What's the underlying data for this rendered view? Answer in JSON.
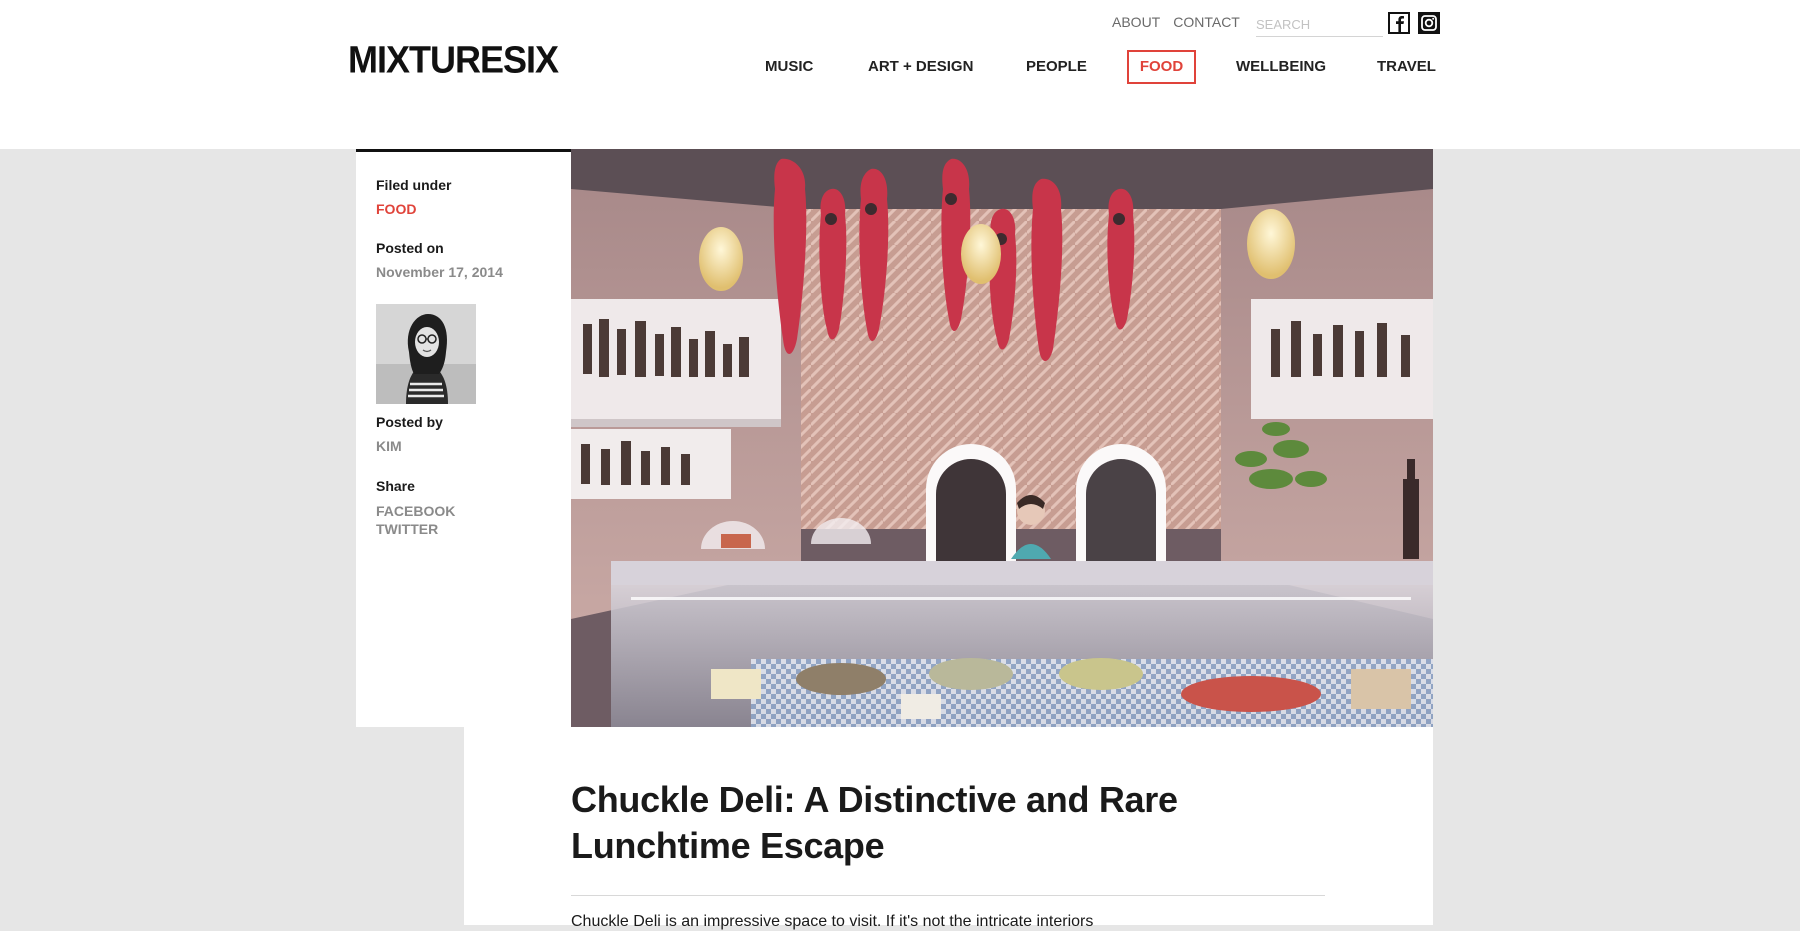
{
  "site": {
    "logo": "MIXTURESIX"
  },
  "utility_nav": {
    "about": "ABOUT",
    "contact": "CONTACT",
    "search_placeholder": "SEARCH",
    "social_icons": [
      "facebook-icon",
      "instagram-icon"
    ]
  },
  "main_nav": {
    "items": [
      {
        "label": "MUSIC"
      },
      {
        "label": "ART + DESIGN"
      },
      {
        "label": "PEOPLE"
      },
      {
        "label": "FOOD",
        "active": true
      },
      {
        "label": "WELLBEING"
      },
      {
        "label": "TRAVEL"
      }
    ]
  },
  "sidebar": {
    "filed_under_label": "Filed under",
    "filed_under_value": "FOOD",
    "posted_on_label": "Posted on",
    "posted_on_value": "November 17, 2014",
    "posted_by_label": "Posted by",
    "posted_by_value": "KIM",
    "share_label": "Share",
    "share_facebook": "FACEBOOK",
    "share_twitter": "TWITTER"
  },
  "article": {
    "title": "Chuckle Deli: A Distinctive and Rare Lunchtime Escape",
    "intro": "Chuckle Deli is an impressive space to visit. If it's not the intricate interiors"
  },
  "colors": {
    "accent": "#e0433a",
    "page_bg": "#e6e6e6",
    "text": "#1a1a1a",
    "muted": "#8a8a8a"
  }
}
